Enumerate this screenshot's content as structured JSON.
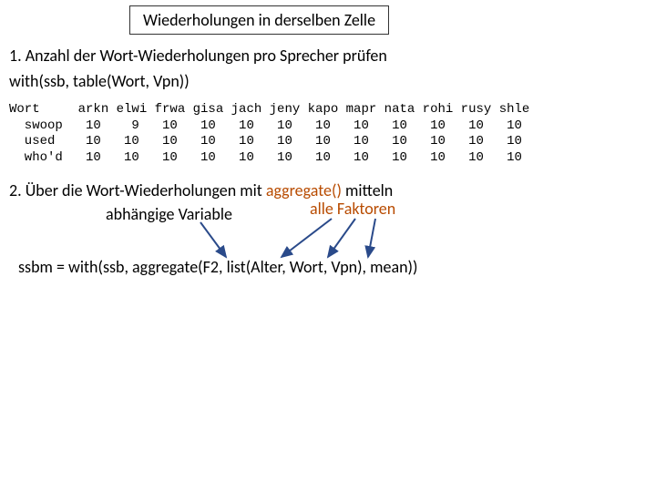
{
  "title": "Wiederholungen in derselben Zelle",
  "step1": "1. Anzahl der Wort-Wiederholungen pro Sprecher prüfen",
  "code1": "with(ssb, table(Wort, Vpn))",
  "mono": "Wort     arkn elwi frwa gisa jach jeny kapo mapr nata rohi rusy shle\n  swoop   10    9   10   10   10   10   10   10   10   10   10   10\n  used    10   10   10   10   10   10   10   10   10   10   10   10\n  who'd   10   10   10   10   10   10   10   10   10   10   10   10",
  "step2_a": "2. Über die Wort-Wiederholungen mit ",
  "step2_b": "aggregate()",
  "step2_c": " mitteln",
  "sub_dep": "abhängige Variable",
  "sub_fac": "alle Faktoren",
  "code2": "ssbm = with(ssb, aggregate(F2, list(Alter, Wort, Vpn), mean))",
  "colors": {
    "accent": "#b84b00"
  }
}
